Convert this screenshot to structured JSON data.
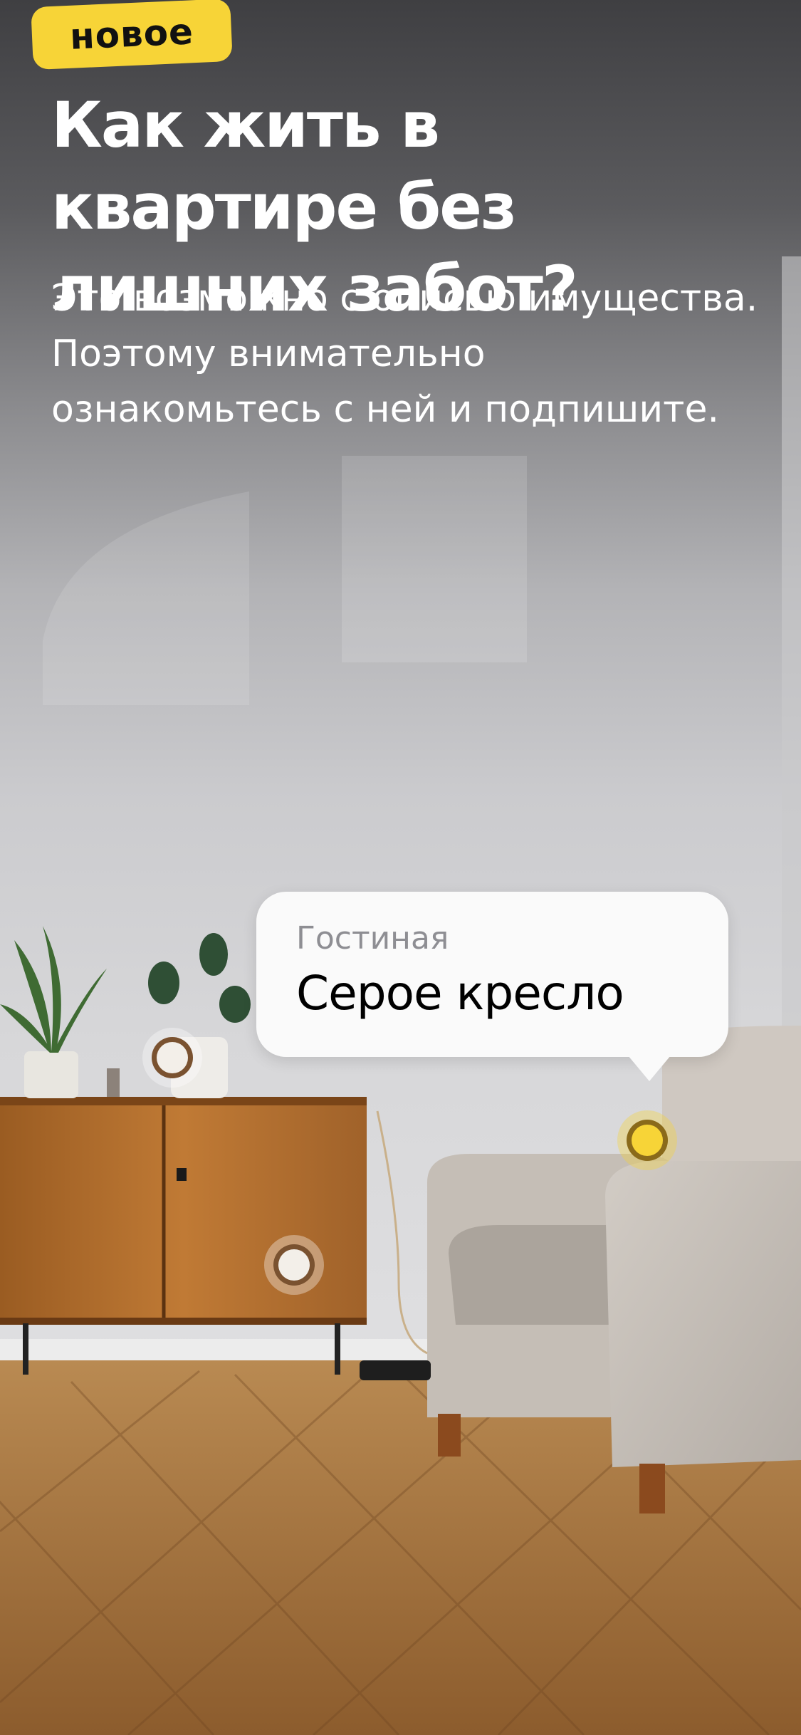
{
  "badge": {
    "label": "новое"
  },
  "header": {
    "title": "Как жить в квартире без лишних забот?",
    "subtitle": "Это возможно с описью имущества. Поэтому внимательно ознакомьтесь с ней и подпишите."
  },
  "tooltip": {
    "room": "Гостиная",
    "item": "Серое кресло"
  },
  "hotspots": [
    {
      "name": "plant",
      "active": false
    },
    {
      "name": "cabinet",
      "active": false
    },
    {
      "name": "armchair",
      "active": true
    }
  ],
  "colors": {
    "accent": "#f7d437",
    "text_primary": "#ffffff",
    "bubble_label": "#8e8e93"
  }
}
